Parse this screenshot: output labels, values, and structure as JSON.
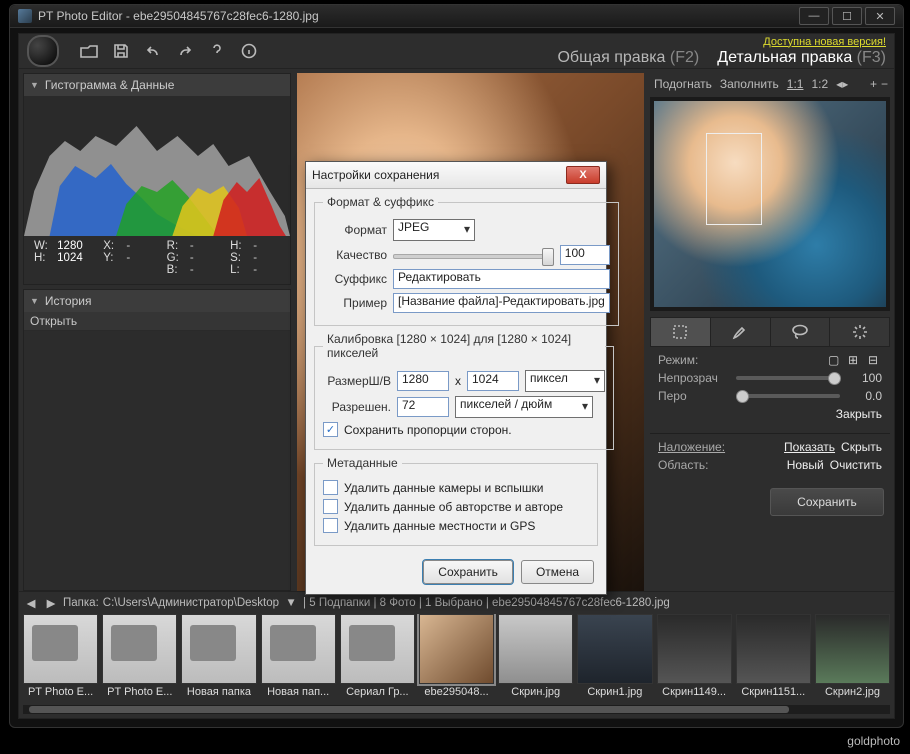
{
  "app": {
    "title": "PT Photo Editor - ebe29504845767c28fec6-1280.jpg"
  },
  "new_version": "Доступна новая версия!",
  "modes": {
    "general": "Общая правка",
    "general_fn": "(F2)",
    "detail": "Детальная правка",
    "detail_fn": "(F3)"
  },
  "left": {
    "histogram_title": "Гистограмма & Данные",
    "history_title": "История",
    "history_items": [
      "Открыть"
    ],
    "meta": {
      "w_label": "W:",
      "w": "1280",
      "x_label": "X:",
      "x": "-",
      "r_label": "R:",
      "r": "-",
      "h0_label": "H:",
      "h0": "-",
      "h_label": "H:",
      "h": "1024",
      "y_label": "Y:",
      "y": "-",
      "g_label": "G:",
      "g": "-",
      "s_label": "S:",
      "s": "-",
      "b_label": "B:",
      "b": "-",
      "l_label": "L:",
      "l": "-"
    }
  },
  "right": {
    "fit": "Подогнать",
    "fill": "Заполнить",
    "one": "1:1",
    "half": "1:2",
    "mode_label": "Режим:",
    "opacity_label": "Непрозрач",
    "opacity_val": "100",
    "feather_label": "Перо",
    "feather_val": "0.0",
    "close": "Закрыть",
    "overlay_label": "Наложение:",
    "overlay_show": "Показать",
    "overlay_hide": "Скрыть",
    "region_label": "Область:",
    "region_new": "Новый",
    "region_clear": "Очистить",
    "save_btn": "Сохранить"
  },
  "path": {
    "label": "Папка:",
    "folder": "C:\\Users\\Администратор\\Desktop",
    "info": "| 5 Подпапки | 8 Фото | 1 Выбрано | ebe29504845767c28fec6-1280.jpg"
  },
  "thumbs": [
    {
      "label": "PT Photo E...",
      "kind": "folder"
    },
    {
      "label": "PT Photo E...",
      "kind": "folder"
    },
    {
      "label": "Новая папка",
      "kind": "folder"
    },
    {
      "label": "Новая пап...",
      "kind": "folder"
    },
    {
      "label": "Сериал Гр...",
      "kind": "folder"
    },
    {
      "label": "ebe295048...",
      "kind": "image",
      "selected": true,
      "bg": "linear-gradient(135deg,#d8b692,#6f4b2e)"
    },
    {
      "label": "Скрин.jpg",
      "kind": "image",
      "bg": "linear-gradient(#c8c8c8,#8f8f8f)"
    },
    {
      "label": "Скрин1.jpg",
      "kind": "image",
      "bg": "linear-gradient(#3a4450,#1e242c)"
    },
    {
      "label": "Скрин1149...",
      "kind": "image",
      "bg": "linear-gradient(#2a2a2a,#555)"
    },
    {
      "label": "Скрин1151...",
      "kind": "image",
      "bg": "linear-gradient(#2a2a2a,#555)"
    },
    {
      "label": "Скрин2.jpg",
      "kind": "image",
      "bg": "linear-gradient(#2a2a2a,#5a7a5a)"
    }
  ],
  "dialog": {
    "title": "Настройки сохранения",
    "legend_format": "Формат & суффикс",
    "format_label": "Формат",
    "format_value": "JPEG",
    "quality_label": "Качество",
    "quality_value": "100",
    "suffix_label": "Суффикс",
    "suffix_value": "Редактировать",
    "example_label": "Пример",
    "example_value": "[Название файла]-Редактировать.jpg",
    "calib": "Калибровка [1280 × 1024] для [1280 × 1024] пикселей",
    "size_label": "РазмерШ/В",
    "w": "1280",
    "x": "x",
    "h": "1024",
    "unit": "пиксел",
    "res_label": "Разрешен.",
    "res": "72",
    "res_unit": "пикселей / дюйм",
    "keep_ratio": "Сохранить пропорции сторон.",
    "legend_meta": "Метаданные",
    "meta1": "Удалить данные камеры и вспышки",
    "meta2": "Удалить данные об авторстве и авторе",
    "meta3": "Удалить данные местности и GPS",
    "save": "Сохранить",
    "cancel": "Отмена"
  },
  "watermark": "goldphoto"
}
